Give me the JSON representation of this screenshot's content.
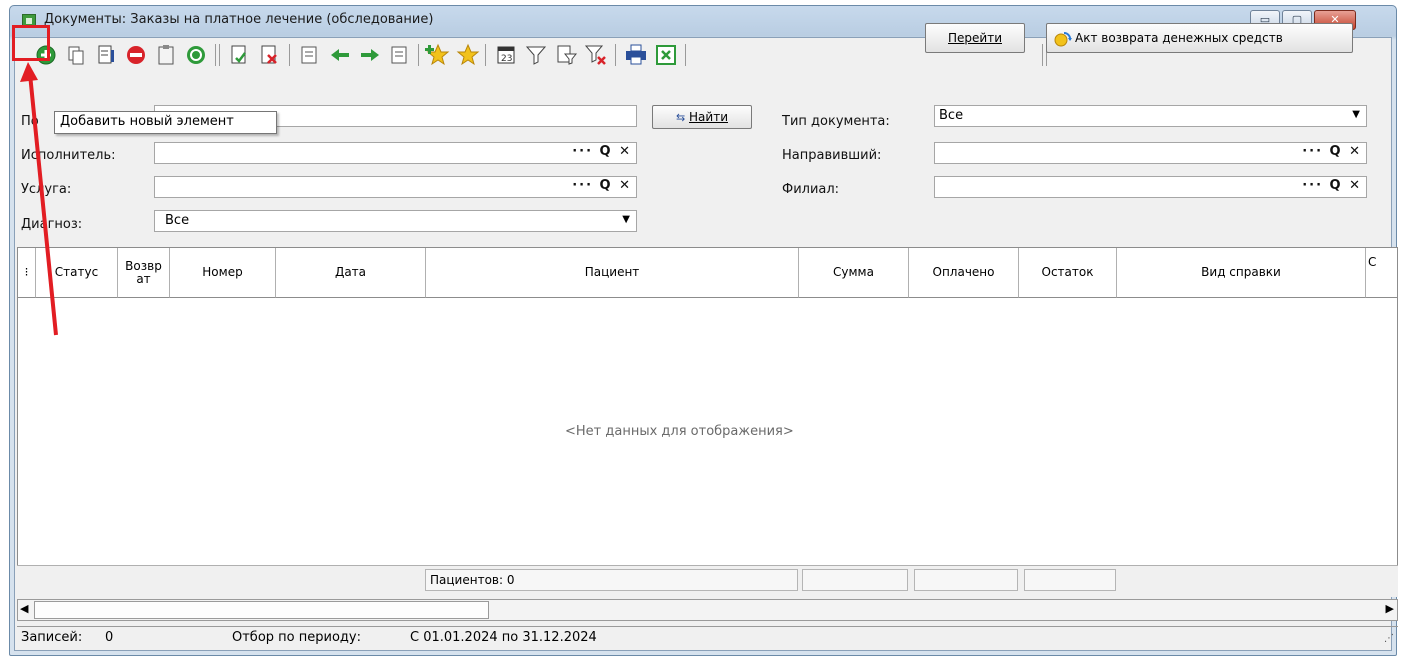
{
  "window": {
    "title": "Документы: Заказы на платное лечение (обследование)",
    "controls": {
      "minimize": "▭",
      "maximize": "▢",
      "close": "✕"
    }
  },
  "toolbar": {
    "navigate_label": "Перейти",
    "refund_act_label": "Акт возврата денежных средств",
    "tooltip": "Добавить новый элемент",
    "add_icon": "plus-circle-icon",
    "highlight_color": "#e21d23"
  },
  "filters": {
    "search_label_partial": "По",
    "find_button": "Найти",
    "executor_label": "Исполнитель:",
    "service_label": "Услуга:",
    "diagnosis_label": "Диагноз:",
    "diagnosis_value": "Все",
    "doc_type_label": "Тип документа:",
    "doc_type_value": "Все",
    "referrer_label": "Направивший:",
    "branch_label": "Филиал:",
    "lookup_icons": "··· Q ✕"
  },
  "grid": {
    "columns": [
      "Статус",
      "Возвр ат",
      "Номер",
      "Дата",
      "Пациент",
      "Сумма",
      "Оплачено",
      "Остаток",
      "Вид справки",
      "С"
    ],
    "empty_text": "<Нет данных для отображения>",
    "footer_patients": "Пациентов: 0"
  },
  "status_bar": {
    "records_label": "Записей:",
    "records_value": "0",
    "period_label": "Отбор по периоду:",
    "period_value": "С 01.01.2024 по 31.12.2024"
  }
}
